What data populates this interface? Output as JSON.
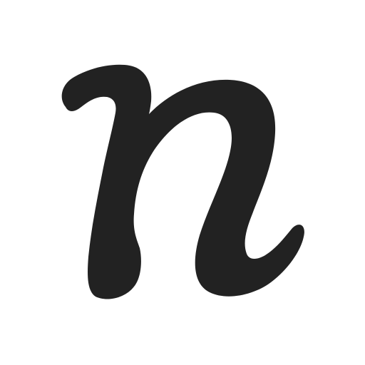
{
  "logo": {
    "letter": "n",
    "icon": "script-letter-n-logo",
    "glyph_color": "#222222",
    "background_color": "#ffffff"
  }
}
